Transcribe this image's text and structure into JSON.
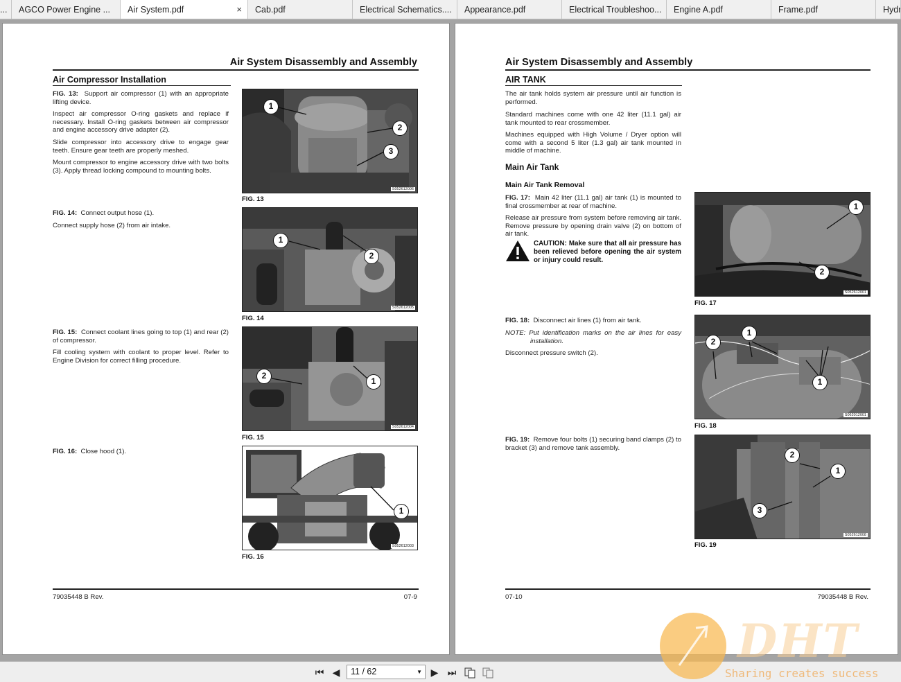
{
  "tabs": [
    {
      "label": "..."
    },
    {
      "label": "AGCO Power Engine ..."
    },
    {
      "label": "Air System.pdf",
      "close": "×"
    },
    {
      "label": "Cab.pdf"
    },
    {
      "label": "Electrical Schematics...."
    },
    {
      "label": "Appearance.pdf"
    },
    {
      "label": "Electrical Troubleshoo..."
    },
    {
      "label": "Engine A.pdf"
    },
    {
      "label": "Frame.pdf"
    },
    {
      "label": "Hydr"
    }
  ],
  "left_page": {
    "title": "Air System Disassembly and Assembly",
    "section": "Air Compressor Installation",
    "fig13": {
      "p1_lead": "FIG. 13:",
      "p1": "Support air compressor (1) with an appropriate lifting device.",
      "p2": "Inspect air compressor O-ring gaskets and replace if necessary. Install O-ring gaskets between air compressor and engine accessory drive adapter (2).",
      "p3": "Slide compressor into accessory drive to engage gear teeth. Ensure gear teeth are properly meshed.",
      "p4": "Mount compressor to engine accessory drive with two bolts (3). Apply thread locking compound to mounting bolts.",
      "label": "FIG. 13",
      "code": "S052612006",
      "callouts": [
        "1",
        "2",
        "3"
      ]
    },
    "fig14": {
      "p1_lead": "FIG. 14:",
      "p1": "Connect output hose (1).",
      "p2": "Connect supply hose (2) from air intake.",
      "label": "FIG. 14",
      "code": "S052612005",
      "callouts": [
        "1",
        "2"
      ]
    },
    "fig15": {
      "p1_lead": "FIG. 15:",
      "p1": "Connect coolant lines going to top (1) and rear (2) of compressor.",
      "p2": "Fill cooling system with coolant to proper level. Refer to Engine Division for correct filling procedure.",
      "label": "FIG. 15",
      "code": "S052612004",
      "callouts": [
        "2",
        "1"
      ]
    },
    "fig16": {
      "p1_lead": "FIG. 16:",
      "p1": "Close hood (1).",
      "label": "FIG. 16",
      "code": "S052612003",
      "callouts": [
        "1"
      ]
    },
    "footer_left": "79035448 B Rev.",
    "footer_right": "07-9"
  },
  "right_page": {
    "title": "Air System Disassembly and Assembly",
    "section": "AIR TANK",
    "intro1": "The air tank holds system air pressure until air function is performed.",
    "intro2": "Standard machines come with one 42 liter (11.1 gal) air tank mounted to rear crossmember.",
    "intro3": "Machines equipped with High Volume / Dryer option will come with a second 5 liter (1.3 gal) air tank mounted in middle of machine.",
    "subsection": "Main Air Tank",
    "subsub": "Main Air Tank Removal",
    "fig17": {
      "p1_lead": "FIG. 17:",
      "p1": "Main 42 liter (11.1 gal) air tank (1) is mounted to final crossmember at rear of machine.",
      "p2": "Release air pressure from system before removing air tank. Remove pressure by opening drain valve (2) on bottom of air tank.",
      "caution": "CAUTION: Make sure that all air pressure has been relieved before opening the air system or injury could result.",
      "label": "FIG. 17",
      "code": "S052612001",
      "callouts": [
        "1",
        "2"
      ]
    },
    "fig18": {
      "p1_lead": "FIG. 18:",
      "p1": "Disconnect air lines (1) from air tank.",
      "note": "NOTE: Put identification marks on the air lines for easy installation.",
      "p2": "Disconnect pressure switch (2).",
      "label": "FIG. 18",
      "code": "S062012001",
      "callouts": [
        "2",
        "1",
        "1"
      ]
    },
    "fig19": {
      "p1_lead": "FIG. 19:",
      "p1": "Remove four bolts (1) securing band clamps (2) to bracket (3) and remove tank assembly.",
      "label": "FIG. 19",
      "code": "S052612008",
      "callouts": [
        "2",
        "1",
        "3"
      ]
    },
    "footer_left": "07-10",
    "footer_right": "79035448 B Rev."
  },
  "toolbar": {
    "page_value": "11 / 62",
    "first": "⏮",
    "prev": "◀",
    "next": "▶",
    "last": "⏭"
  },
  "watermark": {
    "text": "DHT",
    "sub": "Sharing creates success"
  }
}
